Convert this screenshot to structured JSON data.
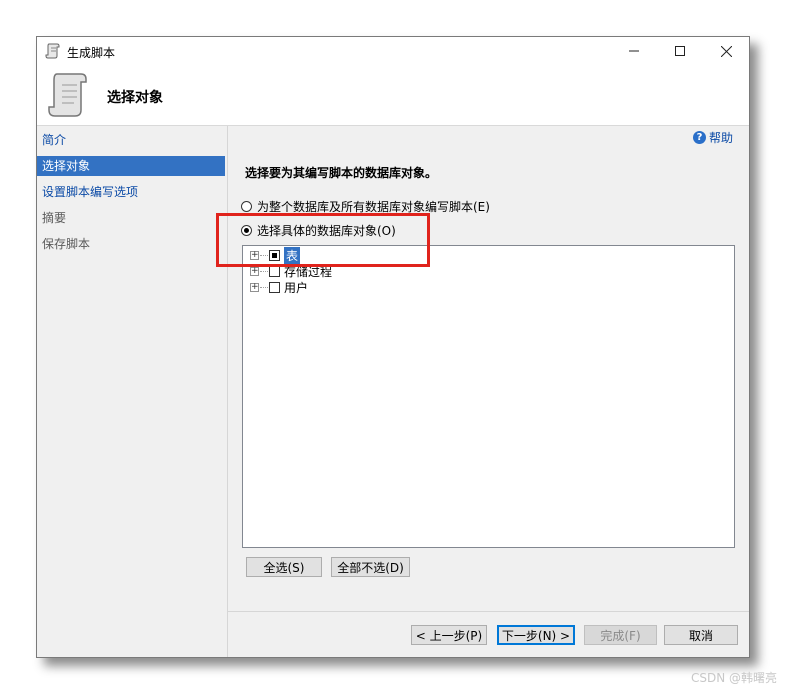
{
  "window": {
    "title": "生成脚本"
  },
  "header": {
    "title": "选择对象"
  },
  "sidebar": {
    "items": [
      {
        "label": "简介"
      },
      {
        "label": "选择对象"
      },
      {
        "label": "设置脚本编写选项"
      },
      {
        "label": "摘要"
      },
      {
        "label": "保存脚本"
      }
    ],
    "active_index": 1
  },
  "content": {
    "help_label": "帮助",
    "section_title": "选择要为其编写脚本的数据库对象。",
    "radio_all": "为整个数据库及所有数据库对象编写脚本(E)",
    "radio_specific": "选择具体的数据库对象(O)",
    "selected_radio": "specific",
    "tree": [
      {
        "label": "表",
        "state": "partial",
        "selected": true
      },
      {
        "label": "存储过程",
        "state": "unchecked",
        "selected": false
      },
      {
        "label": "用户",
        "state": "unchecked",
        "selected": false
      }
    ],
    "select_all_button": "全选(S)",
    "deselect_all_button": "全部不选(D)"
  },
  "footer": {
    "prev_button": "< 上一步(P)",
    "next_button": "下一步(N) >",
    "finish_button": "完成(F)",
    "cancel_button": "取消"
  },
  "watermark": "CSDN @韩曙亮",
  "colors": {
    "accent": "#3372c3",
    "highlight_border": "#e0231c",
    "link": "#0b4aa6"
  }
}
